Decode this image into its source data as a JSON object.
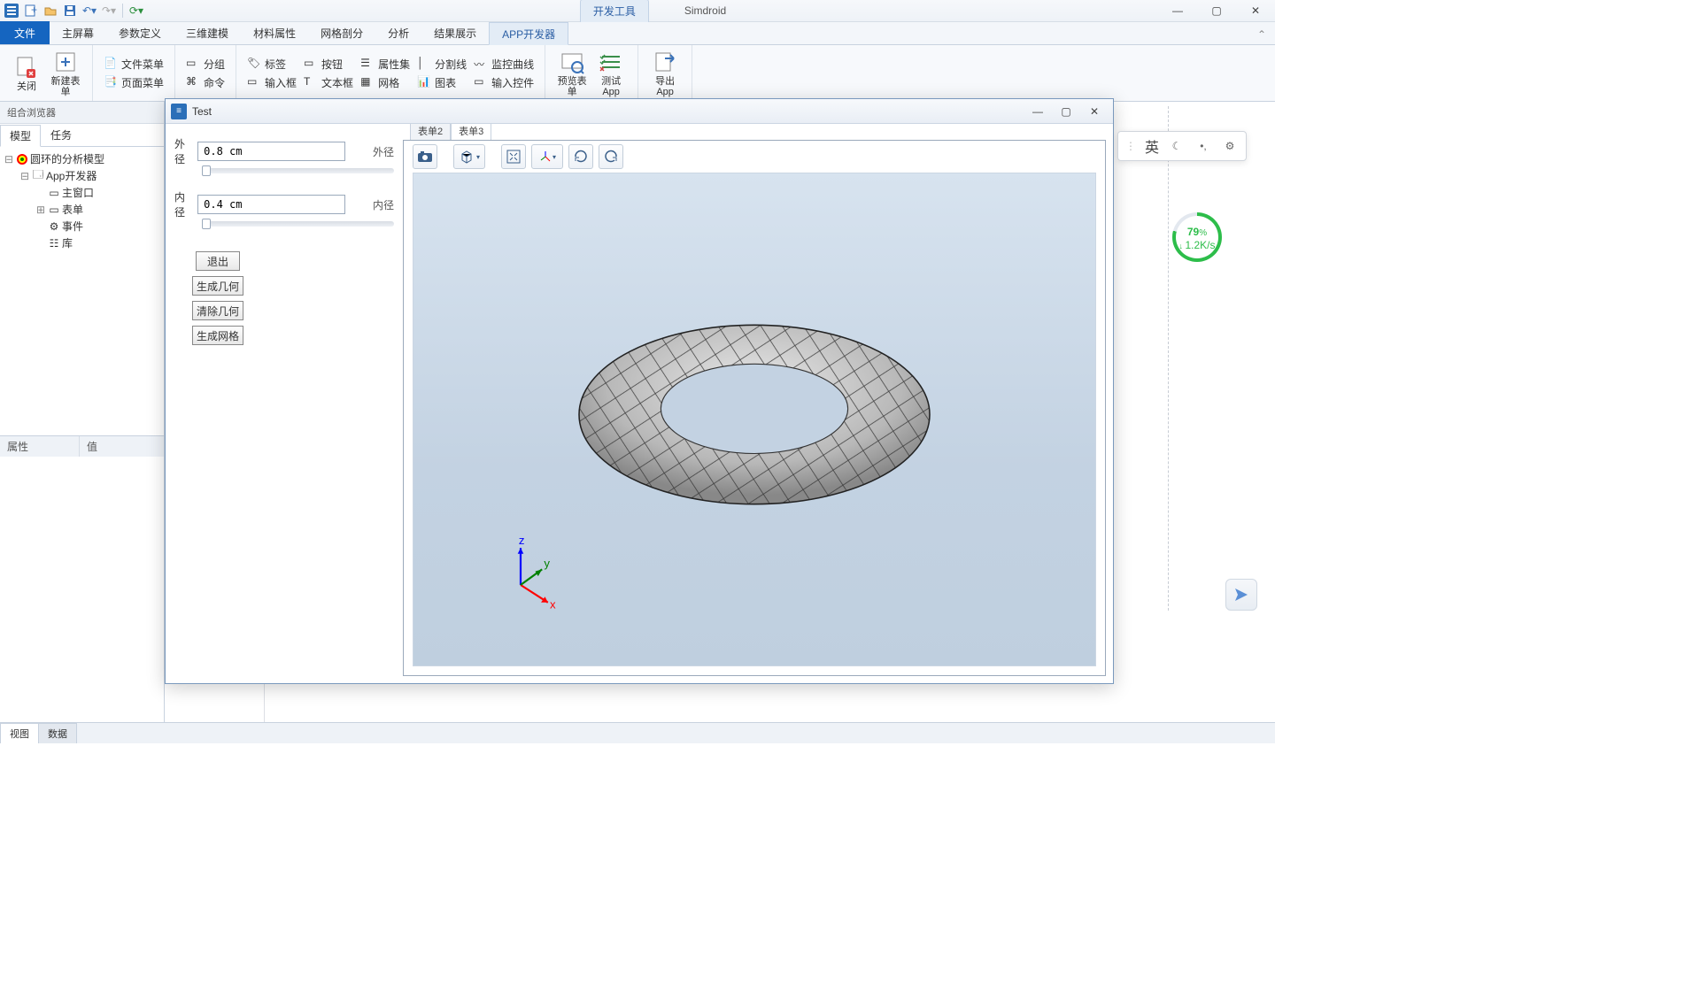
{
  "titlebar": {
    "dev_tab": "开发工具",
    "app_title": "Simdroid"
  },
  "ribbon_tabs": {
    "file": "文件",
    "tabs": [
      "主屏幕",
      "参数定义",
      "三维建模",
      "材料属性",
      "网格剖分",
      "分析",
      "结果展示",
      "APP开发器"
    ],
    "active_index": 7
  },
  "ribbon": {
    "close": "关闭",
    "new_form": "新建表单",
    "file_menu": "文件菜单",
    "page_menu": "页面菜单",
    "group": "分组",
    "command": "命令",
    "tag": "标签",
    "input_box": "输入框",
    "button": "按钮",
    "text_box": "文本框",
    "propset": "属性集",
    "mesh": "网格",
    "split_line": "分割线",
    "chart": "图表",
    "monitor_curve": "监控曲线",
    "input_ctrl": "输入控件",
    "preview_form": "预览表单",
    "test_app": "测试App",
    "export_app": "导出App"
  },
  "left_panel": {
    "title": "组合浏览器",
    "tabs": [
      "模型",
      "任务"
    ],
    "active_tab": 0,
    "tree": {
      "root": "圆环的分析模型",
      "dev": "App开发器",
      "main_window": "主窗口",
      "forms": "表单",
      "events": "事件",
      "lib": "库"
    },
    "prop_headers": [
      "属性",
      "值"
    ]
  },
  "dialog": {
    "title": "Test",
    "field_outer_lbl": "外径",
    "field_outer_val": "0.8 cm",
    "field_outer_right": "外径",
    "field_inner_lbl": "内径",
    "field_inner_val": "0.4 cm",
    "field_inner_right": "内径",
    "btn_exit": "退出",
    "btn_build_geom": "生成几何",
    "btn_clear_geom": "清除几何",
    "btn_build_mesh": "生成网格",
    "vp_tabs": [
      "表单2",
      "表单3"
    ],
    "vp_active": 1
  },
  "statusbar": {
    "tabs": [
      "视图",
      "数据"
    ],
    "active": 0
  },
  "ime": {
    "lang": "英"
  },
  "speed": {
    "pct": "79",
    "unit": "%",
    "rate": "1.2K/s"
  }
}
